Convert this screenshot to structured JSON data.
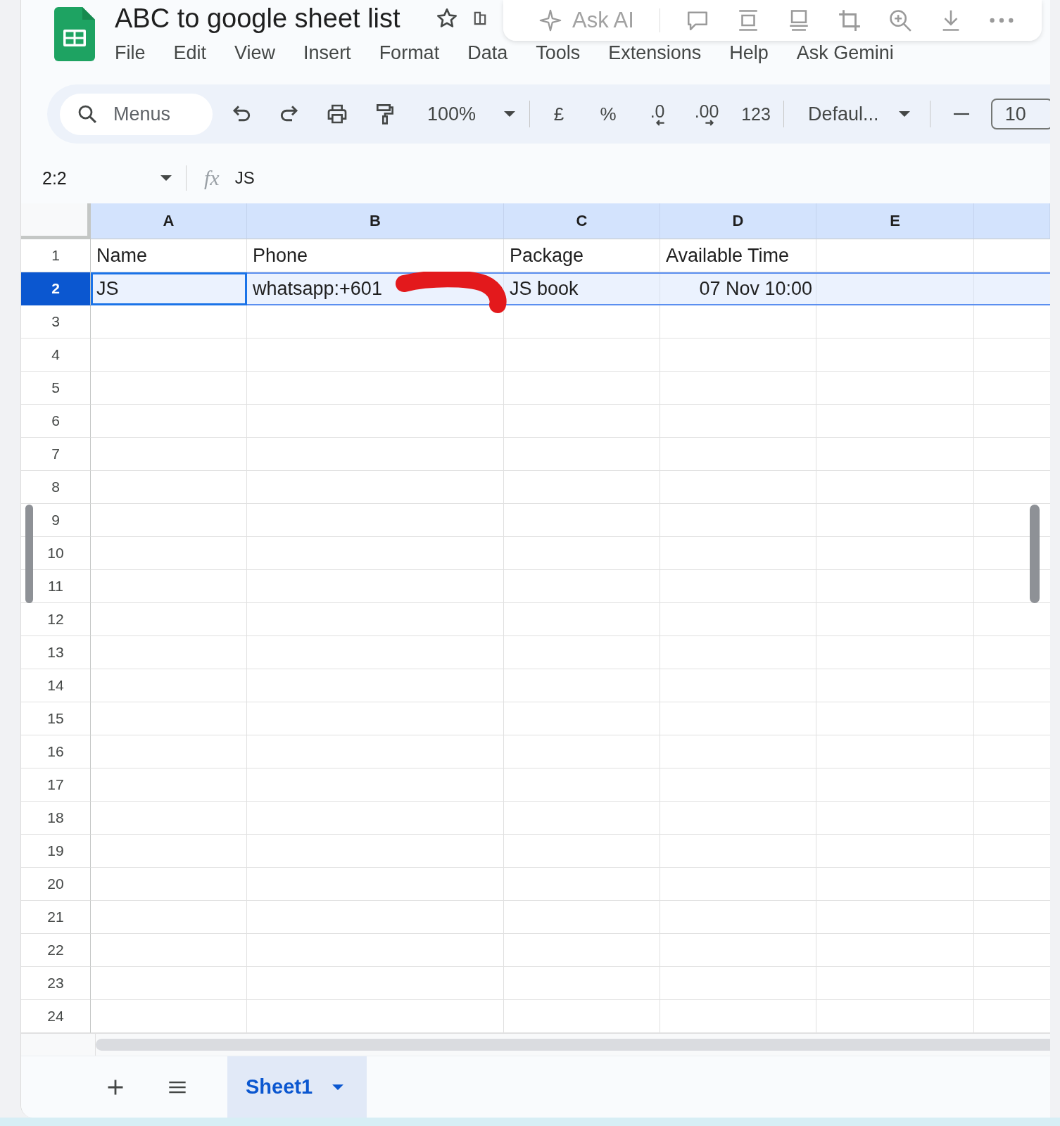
{
  "app": {
    "title": "ABC to google sheet list"
  },
  "menu": [
    "File",
    "Edit",
    "View",
    "Insert",
    "Format",
    "Data",
    "Tools",
    "Extensions",
    "Help",
    "Ask Gemini"
  ],
  "overlay_toolbar": {
    "ask_ai": "Ask AI"
  },
  "toolbar": {
    "search_placeholder": "Menus",
    "zoom": "100%",
    "currency": "£",
    "percent": "%",
    "decrease_decimals": ".0",
    "increase_decimals": ".00",
    "number_formats": "123",
    "font": "Defaul...",
    "font_size": "10"
  },
  "formula_bar": {
    "cell_reference": "2:2",
    "fx": "fx",
    "formula": "JS"
  },
  "columns": [
    "A",
    "B",
    "C",
    "D",
    "E"
  ],
  "rows": [
    {
      "number": "1",
      "selected": false,
      "cells": [
        {
          "text": "Name",
          "kind": "text",
          "active": false
        },
        {
          "text": "Phone",
          "kind": "text",
          "active": false
        },
        {
          "text": "Package",
          "kind": "text",
          "active": false
        },
        {
          "text": "Available Time",
          "kind": "text",
          "active": false
        }
      ]
    },
    {
      "number": "2",
      "selected": true,
      "cells": [
        {
          "text": "JS",
          "kind": "text",
          "active": true
        },
        {
          "text": "whatsapp:+601",
          "kind": "text",
          "active": false
        },
        {
          "text": "JS book",
          "kind": "text",
          "active": false
        },
        {
          "text": "07 Nov 10:00",
          "kind": "date",
          "active": false
        }
      ]
    },
    {
      "number": "3",
      "selected": false
    },
    {
      "number": "4",
      "selected": false
    },
    {
      "number": "5",
      "selected": false
    },
    {
      "number": "6",
      "selected": false
    },
    {
      "number": "7",
      "selected": false
    },
    {
      "number": "8",
      "selected": false
    },
    {
      "number": "9",
      "selected": false
    },
    {
      "number": "10",
      "selected": false
    },
    {
      "number": "11",
      "selected": false
    },
    {
      "number": "12",
      "selected": false
    },
    {
      "number": "13",
      "selected": false
    },
    {
      "number": "14",
      "selected": false
    },
    {
      "number": "15",
      "selected": false
    },
    {
      "number": "16",
      "selected": false
    },
    {
      "number": "17",
      "selected": false
    },
    {
      "number": "18",
      "selected": false
    },
    {
      "number": "19",
      "selected": false
    },
    {
      "number": "20",
      "selected": false
    },
    {
      "number": "21",
      "selected": false
    },
    {
      "number": "22",
      "selected": false
    },
    {
      "number": "23",
      "selected": false
    },
    {
      "number": "24",
      "selected": false
    }
  ],
  "sheet_tabs": [
    {
      "label": "Sheet1",
      "selected": true
    }
  ]
}
